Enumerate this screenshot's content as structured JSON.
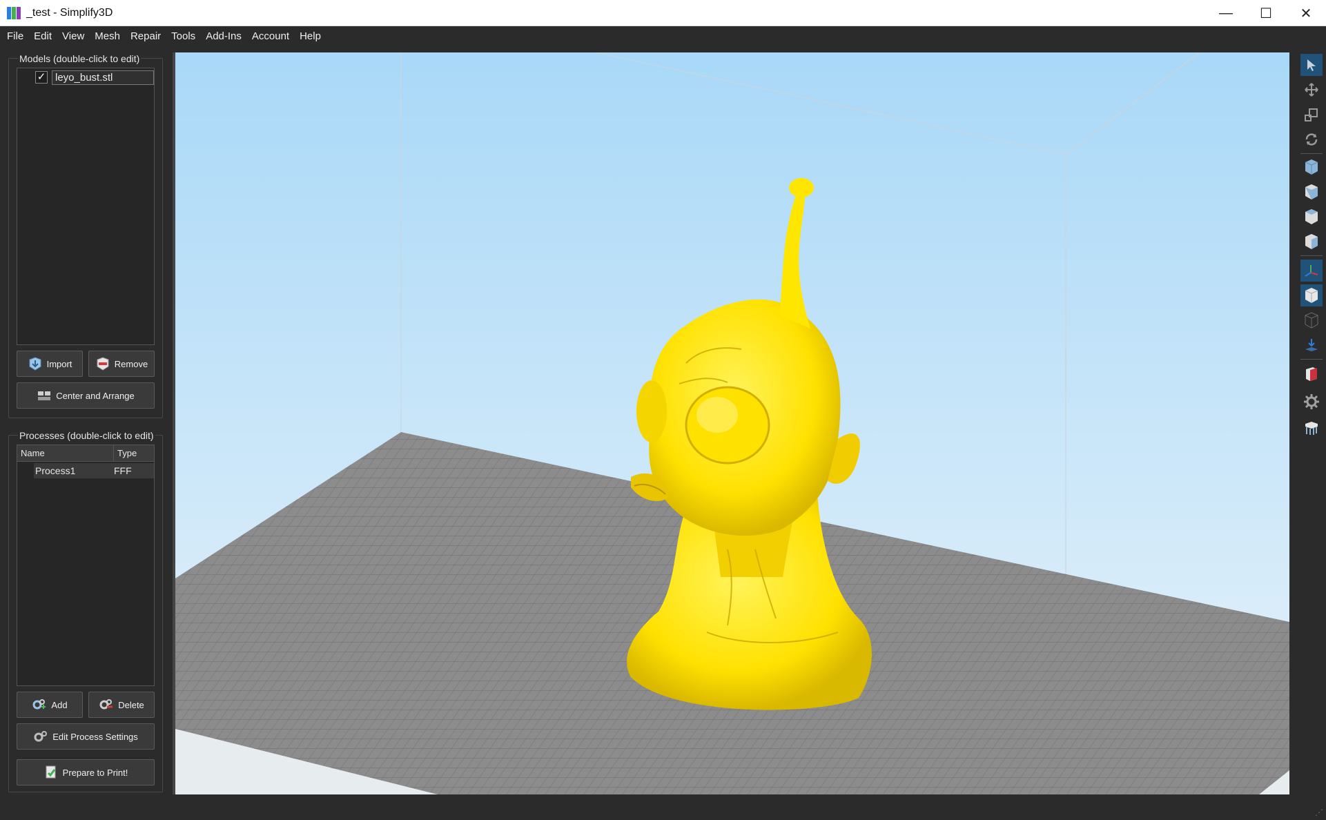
{
  "window": {
    "title": "_test - Simplify3D",
    "minimize_glyph": "—",
    "maximize_glyph": "☐",
    "close_glyph": "✕"
  },
  "menu": [
    "File",
    "Edit",
    "View",
    "Mesh",
    "Repair",
    "Tools",
    "Add-Ins",
    "Account",
    "Help"
  ],
  "models_panel": {
    "title": "Models (double-click to edit)",
    "items": [
      {
        "name": "leyo_bust.stl",
        "checked": true,
        "check_glyph": "✓"
      }
    ],
    "import_label": "Import",
    "remove_label": "Remove",
    "center_arrange_label": "Center and Arrange"
  },
  "processes_panel": {
    "title": "Processes (double-click to edit)",
    "columns": [
      "Name",
      "Type"
    ],
    "rows": [
      {
        "name": "Process1",
        "type": "FFF"
      }
    ],
    "add_label": "Add",
    "delete_label": "Delete",
    "edit_settings_label": "Edit Process Settings",
    "prepare_label": "Prepare to Print!"
  },
  "viewport": {
    "model_color": "#ffe600",
    "bed_color": "#8c8c8c",
    "sky_top": "#a9d8f8",
    "sky_bottom": "#e8f3fa"
  },
  "right_toolbar": {
    "tools": [
      {
        "icon": "select-cursor-icon",
        "active": true
      },
      {
        "icon": "move-arrows-icon",
        "active": false
      },
      {
        "icon": "scale-icon",
        "active": false
      },
      {
        "icon": "rotate-icon",
        "active": false
      },
      {
        "icon": "view-iso-cube-icon",
        "active": false
      },
      {
        "icon": "view-front-cube-icon",
        "active": false
      },
      {
        "icon": "view-side-cube-icon",
        "active": false
      },
      {
        "icon": "view-top-cube-icon",
        "active": false
      },
      {
        "icon": "axes-icon",
        "active": true
      },
      {
        "icon": "solid-cube-icon",
        "active": true
      },
      {
        "icon": "wireframe-cube-icon",
        "active": false
      },
      {
        "icon": "bed-drop-icon",
        "active": false
      },
      {
        "icon": "cross-section-icon",
        "active": false
      },
      {
        "icon": "settings-gear-icon",
        "active": false
      },
      {
        "icon": "supports-icon",
        "active": false
      }
    ]
  }
}
